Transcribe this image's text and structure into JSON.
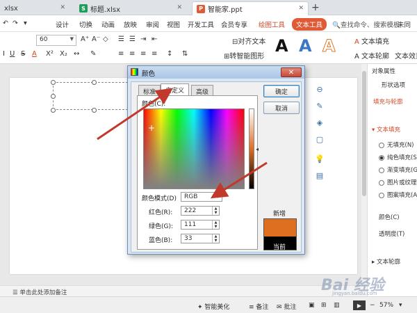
{
  "tabs": [
    {
      "label": "xlsx",
      "icon": "",
      "active": false
    },
    {
      "label": "标题.xlsx",
      "icon": "S",
      "active": false
    },
    {
      "label": "智能家.ppt",
      "icon": "P",
      "active": true
    }
  ],
  "menu": {
    "items": [
      "设计",
      "切换",
      "动画",
      "放映",
      "审阅",
      "视图",
      "开发工具",
      "会员专享"
    ],
    "drawing_tools": "绘图工具",
    "text_tools": "文本工具",
    "search": "查找命令、搜索模板",
    "sync": "未同"
  },
  "toolbar": {
    "font_size": "60",
    "align_text": "对齐文本",
    "smart_shape": "转智能图形",
    "text_fill": "文本填充",
    "text_outline": "文本轮廓",
    "text_effect": "文本效果",
    "font_btn_u": "U",
    "font_btn_a": "A",
    "font_btn_s": "S"
  },
  "right_panel": {
    "title": "对象属性",
    "tab_shape": "形状选项",
    "fill_outline": "填充与轮廓",
    "text_fill_section": "文本填充",
    "options": [
      "无填充(N)",
      "纯色填充(S)",
      "渐变填充(G)",
      "图片或纹理填充",
      "图案填充(A)"
    ],
    "selected_option": 1,
    "color_label": "颜色(C)",
    "transparency_label": "透明度(T)",
    "text_outline_section": "文本轮廓"
  },
  "notes": {
    "placeholder": "单击此处添加备注"
  },
  "status": {
    "smart_beautify": "智能美化",
    "notes": "备注",
    "comments": "批注",
    "zoom": "57%"
  },
  "dialog": {
    "title": "颜色",
    "tabs": [
      "标准",
      "自定义",
      "高级"
    ],
    "active_tab": 1,
    "colors_label": "颜色(C):",
    "mode_label": "颜色模式(D)",
    "mode_value": "RGB",
    "red_label": "红色(R):",
    "red_value": "222",
    "green_label": "绿色(G):",
    "green_value": "111",
    "blue_label": "蓝色(B):",
    "blue_value": "33",
    "ok": "确定",
    "cancel": "取消",
    "new_label": "新增",
    "current_label": "当前",
    "new_color": "#de6f21",
    "current_color": "#000000"
  },
  "watermark": {
    "text": "Bai 经验",
    "sub": "jingyan.baidu.com"
  },
  "colors": {
    "accent": "#d24726",
    "arrow": "#c0392b"
  }
}
